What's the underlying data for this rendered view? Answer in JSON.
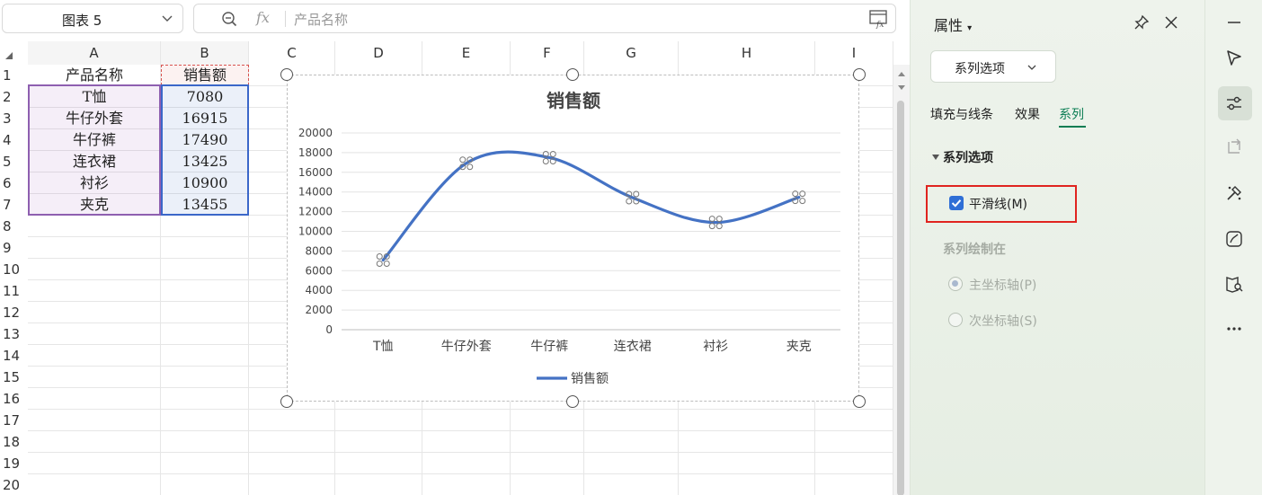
{
  "formula_bar": {
    "name_box": "图表 5",
    "fx_label": "fx",
    "content": "产品名称"
  },
  "sheet": {
    "columns": [
      "A",
      "B",
      "C",
      "D",
      "E",
      "F",
      "G",
      "H",
      "I"
    ],
    "rows": [
      "1",
      "2",
      "3",
      "4",
      "5",
      "6",
      "7",
      "8",
      "9",
      "10",
      "11",
      "12",
      "13",
      "14",
      "15",
      "16",
      "17",
      "18",
      "19",
      "20"
    ],
    "header_a": "产品名称",
    "header_b": "销售额",
    "data": [
      {
        "name": "T恤",
        "sales": "7080"
      },
      {
        "name": "牛仔外套",
        "sales": "16915"
      },
      {
        "name": "牛仔裤",
        "sales": "17490"
      },
      {
        "name": "连衣裙",
        "sales": "13425"
      },
      {
        "name": "衬衫",
        "sales": "10900"
      },
      {
        "name": "夹克",
        "sales": "13455"
      }
    ]
  },
  "chart_data": {
    "type": "line",
    "title": "销售额",
    "categories": [
      "T恤",
      "牛仔外套",
      "牛仔裤",
      "连衣裙",
      "衬衫",
      "夹克"
    ],
    "series": [
      {
        "name": "销售额",
        "values": [
          7080,
          16915,
          17490,
          13425,
          10900,
          13455
        ],
        "color": "#4472c4"
      }
    ],
    "ylim": [
      0,
      20000
    ],
    "yticks": [
      "20000",
      "18000",
      "16000",
      "14000",
      "12000",
      "10000",
      "8000",
      "6000",
      "4000",
      "2000",
      "0"
    ],
    "smooth": true,
    "grid": true,
    "legend": "bottom"
  },
  "panel": {
    "title": "属性",
    "dropdown": "系列选项",
    "tabs": [
      "填充与线条",
      "效果",
      "系列"
    ],
    "active_tab": "系列",
    "section": "系列选项",
    "smooth_label": "平滑线(M)",
    "smooth_checked": true,
    "plot_on": "系列绘制在",
    "primary_axis": "主坐标轴(P)",
    "secondary_axis": "次坐标轴(S)",
    "accent": "#0a7d53",
    "highlight": "#e0241f"
  },
  "toolbar_icons": [
    "minimize-icon",
    "select-pointer-icon",
    "properties-icon",
    "transform-icon",
    "style-tools-icon",
    "chart-style-icon",
    "book-search-icon",
    "more-icon"
  ]
}
